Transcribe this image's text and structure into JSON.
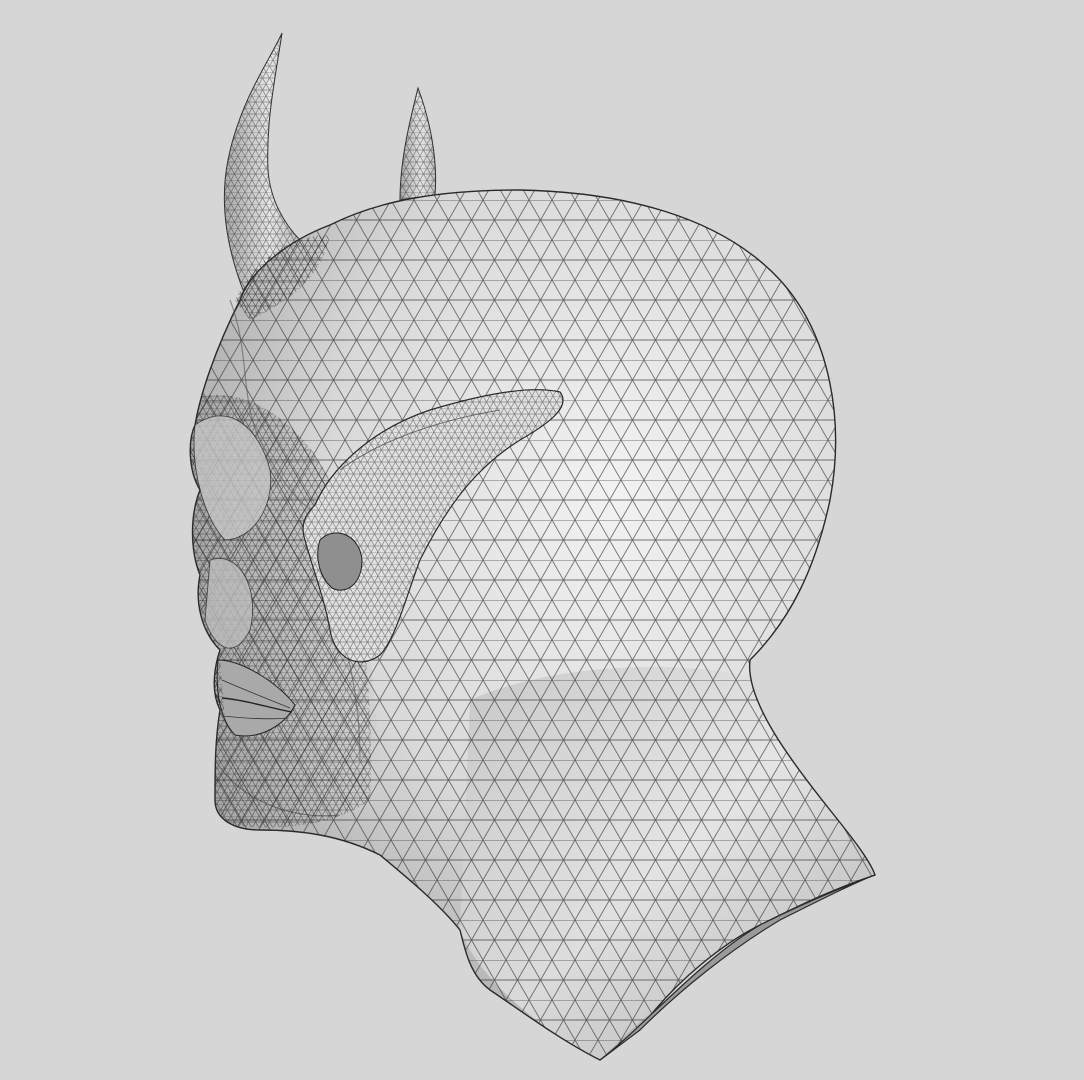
{
  "scene": {
    "background_color": "#d6d6d6",
    "mesh_fill_color": "#e6e6e6",
    "wire_color": "#1a1a1a",
    "model_name_visible": "",
    "render_mode": "wireframe-on-shaded"
  }
}
